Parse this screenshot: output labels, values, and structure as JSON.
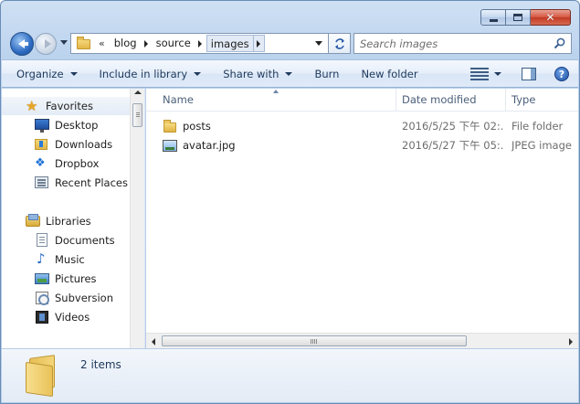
{
  "window": {
    "controls": {
      "minimize": "minimize",
      "maximize": "maximize",
      "close": "close"
    }
  },
  "address": {
    "overflow": "«",
    "breadcrumbs": [
      "blog",
      "source",
      "images"
    ]
  },
  "search": {
    "placeholder": "Search images"
  },
  "toolbar": {
    "organize": "Organize",
    "include_in_library": "Include in library",
    "share_with": "Share with",
    "burn": "Burn",
    "new_folder": "New folder"
  },
  "nav": {
    "favorites": {
      "label": "Favorites",
      "items": [
        "Desktop",
        "Downloads",
        "Dropbox",
        "Recent Places"
      ]
    },
    "libraries": {
      "label": "Libraries",
      "items": [
        "Documents",
        "Music",
        "Pictures",
        "Subversion",
        "Videos"
      ]
    }
  },
  "columns": {
    "name": "Name",
    "date": "Date modified",
    "type": "Type"
  },
  "files": [
    {
      "name": "posts",
      "date": "2016/5/25 下午 02:...",
      "type": "File folder",
      "icon": "folder-icon"
    },
    {
      "name": "avatar.jpg",
      "date": "2016/5/27 下午 05:...",
      "type": "JPEG image",
      "icon": "image-file-icon"
    }
  ],
  "details": {
    "count": "2 items"
  },
  "colors": {
    "accent": "#1e395b",
    "frame": "#b4cbe8",
    "close": "#c13a24"
  }
}
